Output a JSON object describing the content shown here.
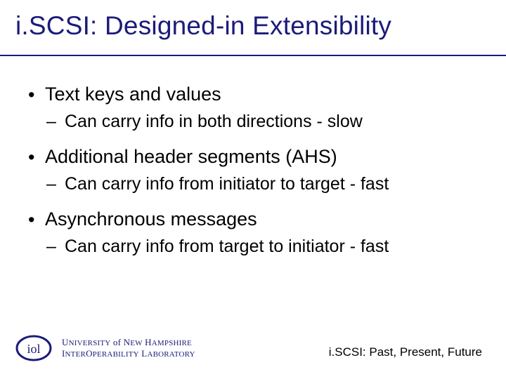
{
  "title": "i.SCSI: Designed-in Extensibility",
  "bullets": [
    {
      "text": "Text keys and values",
      "sub": [
        "Can carry info in both directions - slow"
      ]
    },
    {
      "text": "Additional header segments (AHS)",
      "sub": [
        "Can carry info from initiator to target - fast"
      ]
    },
    {
      "text": "Asynchronous messages",
      "sub": [
        "Can carry info from target to initiator - fast"
      ]
    }
  ],
  "footer": {
    "org": {
      "line1_caps1": "U",
      "line1_sc1": "NIVERSITY",
      "line1_of": " of ",
      "line1_caps2": "N",
      "line1_sc2": "EW",
      "line1_sp": " ",
      "line1_caps3": "H",
      "line1_sc3": "AMPSHIRE",
      "line2_caps1": "I",
      "line2_sc1": "NTER",
      "line2_caps2": "O",
      "line2_sc2": "PERABILITY",
      "line2_sp": " ",
      "line2_caps3": "L",
      "line2_sc3": "ABORATORY"
    },
    "right": "i.SCSI: Past, Present, Future",
    "logo_text": "iol"
  },
  "colors": {
    "brand": "#1b1b7a"
  }
}
